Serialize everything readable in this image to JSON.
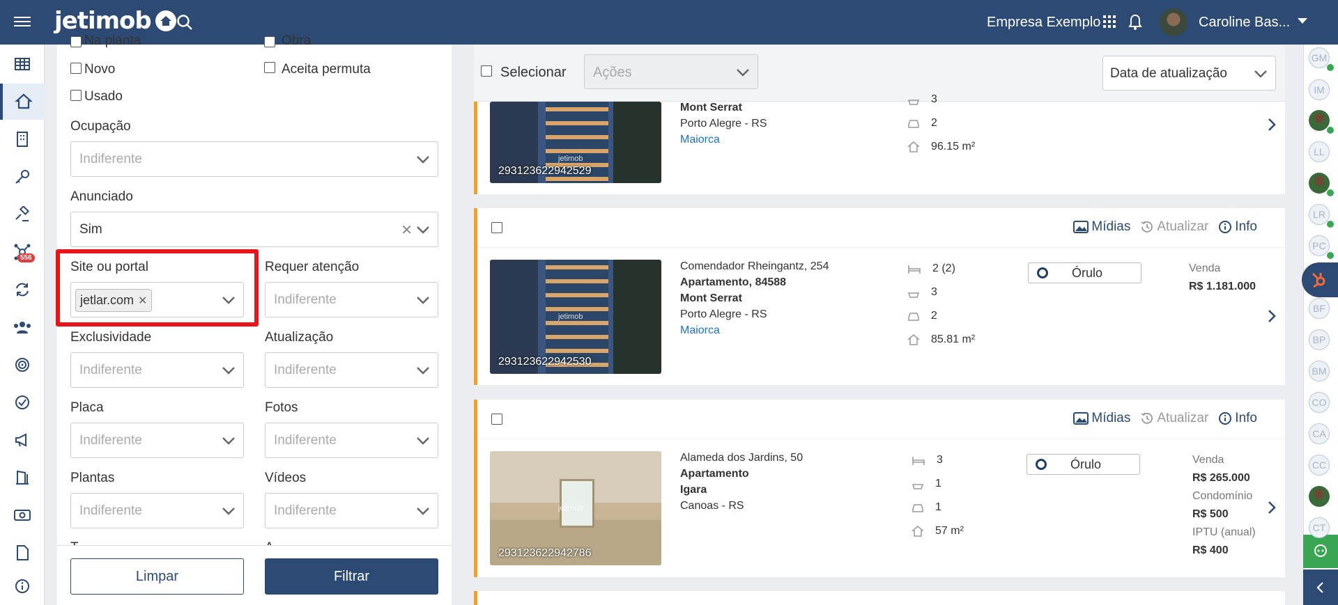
{
  "header": {
    "logo": "jetimob",
    "company": "Empresa Exemplo",
    "user": "Caroline Bas..."
  },
  "nav": {
    "badge": "556"
  },
  "filters": {
    "cb_top_left": "Na planta",
    "cb_top_right": "Obra",
    "cb_novo": "Novo",
    "cb_aceita": "Aceita permuta",
    "cb_usado": "Usado",
    "ocupacao_label": "Ocupação",
    "anunciado_label": "Anunciado",
    "anunciado_value": "Sim",
    "site_label": "Site ou portal",
    "site_chip": "jetlar.com",
    "requer_label": "Requer atenção",
    "exclusividade_label": "Exclusividade",
    "atualizacao_label": "Atualização",
    "placa_label": "Placa",
    "fotos_label": "Fotos",
    "plantas_label": "Plantas",
    "videos_label": "Vídeos",
    "placeholder": "Indiferente",
    "cut_left": "T",
    "cut_right": "A",
    "limpar": "Limpar",
    "filtrar": "Filtrar"
  },
  "listbar": {
    "selecionar": "Selecionar",
    "acoes": "Ações",
    "sort": "Data de atualização"
  },
  "actions": {
    "midias": "Mídias",
    "atualizar": "Atualizar",
    "info": "Info"
  },
  "cards": [
    {
      "code": "293123622942529",
      "address": "",
      "type": "",
      "building": "Mont Serrat",
      "city": "Porto Alegre - RS",
      "builder": "Maiorca",
      "bedrooms": "",
      "bathrooms": "3",
      "parking": "2",
      "area": "96.15 m²"
    },
    {
      "code": "293123622942530",
      "address": "Comendador Rheingantz, 254",
      "type": "Apartamento, 84588",
      "building": "Mont Serrat",
      "city": "Porto Alegre - RS",
      "builder": "Maiorca",
      "bedrooms": "2 (2)",
      "bathrooms": "3",
      "parking": "2",
      "area": "85.81 m²",
      "orulo": "Órulo",
      "price_type": "Venda",
      "price": "R$ 1.181.000"
    },
    {
      "code": "293123622942786",
      "address": "Alameda dos Jardins, 50",
      "type": "Apartamento",
      "building": "Igara",
      "city": "Canoas - RS",
      "bedrooms": "3",
      "bathrooms": "1",
      "parking": "1",
      "area": "57 m²",
      "orulo": "Órulo",
      "price_type": "Venda",
      "price": "R$ 265.000",
      "condo_label": "Condomínio",
      "condo": "R$ 500",
      "iptu_label": "IPTU (anual)",
      "iptu": "R$ 400"
    }
  ],
  "sidebar_users": [
    "GM",
    "IM",
    "",
    "LL",
    "",
    "LR",
    "PC",
    "",
    "BF",
    "BP",
    "BM",
    "CO",
    "CA",
    "CC",
    "",
    "CT"
  ],
  "colors": {
    "primary": "#2c4a73",
    "accent": "#f0a030",
    "highlight": "#e8141a",
    "online": "#3aa553"
  }
}
